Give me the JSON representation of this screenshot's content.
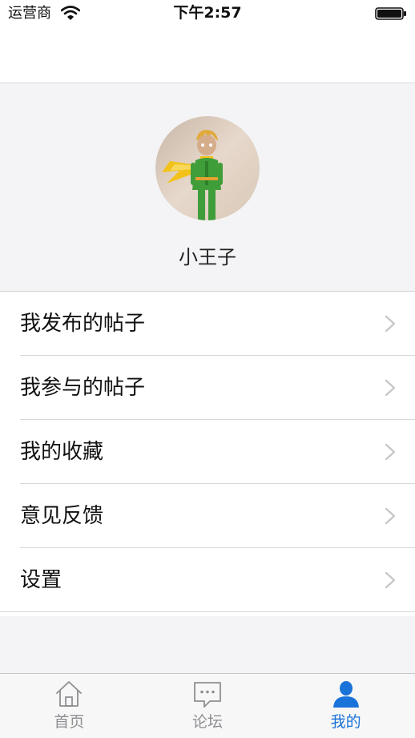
{
  "status_bar": {
    "carrier": "运营商",
    "time": "下午2:57"
  },
  "profile": {
    "username": "小王子"
  },
  "menu": {
    "items": [
      {
        "label": "我发布的帖子"
      },
      {
        "label": "我参与的帖子"
      },
      {
        "label": "我的收藏"
      },
      {
        "label": "意见反馈"
      },
      {
        "label": "设置"
      }
    ]
  },
  "tab_bar": {
    "tabs": [
      {
        "label": "首页",
        "icon": "home-icon",
        "active": false
      },
      {
        "label": "论坛",
        "icon": "chat-bubble-icon",
        "active": false
      },
      {
        "label": "我的",
        "icon": "person-icon",
        "active": true
      }
    ]
  },
  "colors": {
    "accent": "#1a73d9",
    "inactive": "#8e8e93",
    "background": "#f4f4f6"
  }
}
